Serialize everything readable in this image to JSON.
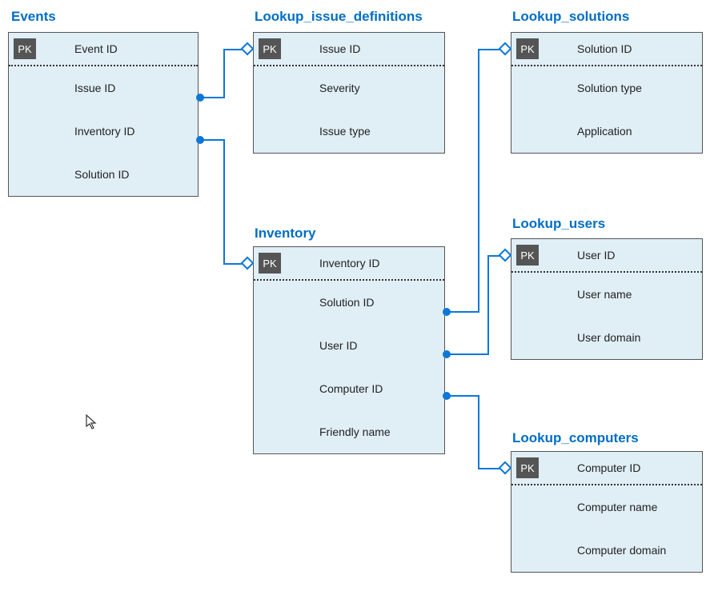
{
  "entities": {
    "events": {
      "title": "Events",
      "pk": "Event ID",
      "attrs": [
        "Issue ID",
        "Inventory ID",
        "Solution ID"
      ]
    },
    "lookup_issue_definitions": {
      "title": "Lookup_issue_definitions",
      "pk": "Issue ID",
      "attrs": [
        "Severity",
        "Issue type"
      ]
    },
    "lookup_solutions": {
      "title": "Lookup_solutions",
      "pk": "Solution ID",
      "attrs": [
        "Solution type",
        "Application"
      ]
    },
    "inventory": {
      "title": "Inventory",
      "pk": "Inventory ID",
      "attrs": [
        "Solution ID",
        "User ID",
        "Computer ID",
        "Friendly name"
      ]
    },
    "lookup_users": {
      "title": "Lookup_users",
      "pk": "User ID",
      "attrs": [
        "User name",
        "User domain"
      ]
    },
    "lookup_computers": {
      "title": "Lookup_computers",
      "pk": "Computer ID",
      "attrs": [
        "Computer name",
        "Computer domain"
      ]
    }
  },
  "pk_badge": "PK",
  "relationships": [
    {
      "from": "events.Issue ID",
      "to": "lookup_issue_definitions.Issue ID"
    },
    {
      "from": "events.Inventory ID",
      "to": "inventory.Inventory ID"
    },
    {
      "from": "inventory.Solution ID",
      "to": "lookup_solutions.Solution ID"
    },
    {
      "from": "inventory.User ID",
      "to": "lookup_users.User ID"
    },
    {
      "from": "inventory.Computer ID",
      "to": "lookup_computers.Computer ID"
    }
  ],
  "colors": {
    "accent": "#006dc6",
    "connector": "#0b77d8",
    "entity_bg": "#e0eef5",
    "pk_bg": "#555555"
  }
}
